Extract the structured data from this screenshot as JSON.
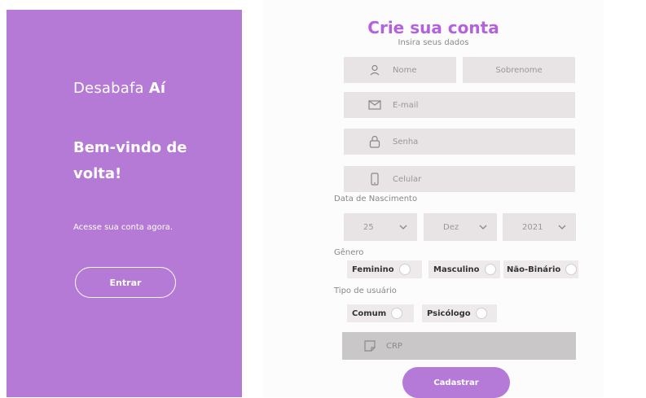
{
  "left": {
    "brand_prefix": "Desabafa",
    "brand_strong": "Aí",
    "welcome": "Bem-vindo de volta!",
    "subtext": "Acesse sua conta agora.",
    "enter_button": "Entrar"
  },
  "form": {
    "title": "Crie sua conta",
    "subtitle": "Insira seus dados",
    "nome_placeholder": "Nome",
    "sobrenome_placeholder": "Sobrenome",
    "email_placeholder": "E-mail",
    "senha_placeholder": "Senha",
    "celular_placeholder": "Celular",
    "birth_label": "Data de Nascimento",
    "birth_day": "25",
    "birth_month": "Dez",
    "birth_year": "2021",
    "gender_label": "Gênero",
    "gender_options": [
      "Feminino",
      "Masculino",
      "Não-Binário"
    ],
    "user_type_label": "Tipo de usuário",
    "user_type_options": [
      "Comum",
      "Psicólogo"
    ],
    "crp_placeholder": "CRP",
    "submit_button": "Cadastrar"
  },
  "icons": {
    "nome": "user-icon",
    "email": "envelope-icon",
    "senha": "lock-icon",
    "celular": "phone-icon",
    "crp": "note-icon",
    "select": "chevron-down-icon"
  },
  "colors": {
    "left_panel": "#b47ad6",
    "title": "#b262dc",
    "field_bg": "#e8e4e6",
    "submit_bg": "#b57ad8",
    "crp_bg": "#c9c7c8"
  }
}
